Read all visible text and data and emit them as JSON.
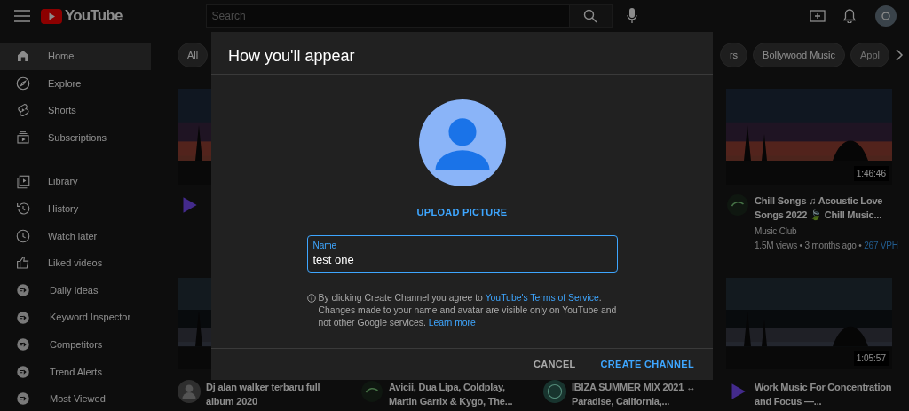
{
  "header": {
    "logo": "YouTube",
    "search": {
      "placeholder": "Search"
    }
  },
  "sidebar": {
    "items": [
      {
        "label": "Home",
        "selected": true
      },
      {
        "label": "Explore",
        "selected": false
      },
      {
        "label": "Shorts",
        "selected": false
      },
      {
        "label": "Subscriptions",
        "selected": false
      },
      {
        "label": "Library",
        "selected": false
      },
      {
        "label": "History",
        "selected": false
      },
      {
        "label": "Watch later",
        "selected": false
      },
      {
        "label": "Liked videos",
        "selected": false
      },
      {
        "label": "Daily Ideas",
        "selected": false
      },
      {
        "label": "Keyword Inspector",
        "selected": false
      },
      {
        "label": "Competitors",
        "selected": false
      },
      {
        "label": "Trend Alerts",
        "selected": false
      },
      {
        "label": "Most Viewed",
        "selected": false
      }
    ]
  },
  "chips": [
    {
      "label": "All"
    },
    {
      "label": "rs"
    },
    {
      "label": "Bollywood Music"
    },
    {
      "label": "Appl"
    }
  ],
  "video_rows": [
    {
      "items": [
        {
          "kind": "thumb"
        },
        {
          "kind": "covered"
        },
        {
          "kind": "covered"
        },
        {
          "kind": "full",
          "duration": "1:46:46",
          "title": "Chill Songs ♫ Acoustic Love Songs 2022 🍃 Chill Music...",
          "channel": "Music Club",
          "meta": "1.5M views • 3 months ago •",
          "vph": "267 VPH"
        }
      ]
    },
    {
      "items": [
        {
          "kind": "full",
          "title": "Dj alan walker terbaru full album 2020"
        },
        {
          "kind": "info",
          "title": "Avicii, Dua Lipa, Coldplay, Martin Garrix & Kygo, The..."
        },
        {
          "kind": "info",
          "title": "IBIZA SUMMER MIX 2021 ↔ Paradise, California,..."
        },
        {
          "kind": "full",
          "duration": "1:05:57",
          "title": "Work Music For Concentration and Focus —..."
        }
      ]
    }
  ],
  "dialog": {
    "title": "How you'll appear",
    "upload": "UPLOAD PICTURE",
    "name_field": {
      "label": "Name",
      "value": "test one",
      "focused": true
    },
    "notice": {
      "before": "By clicking Create Channel you agree to ",
      "terms_link": "YouTube's Terms of Service",
      "middle": ". Changes made to your name and avatar are visible only on YouTube and not other Google services. ",
      "learn_link": "Learn more"
    },
    "buttons": [
      {
        "label": "CANCEL",
        "kind": "secondary"
      },
      {
        "label": "CREATE CHANNEL",
        "kind": "primary"
      }
    ]
  }
}
